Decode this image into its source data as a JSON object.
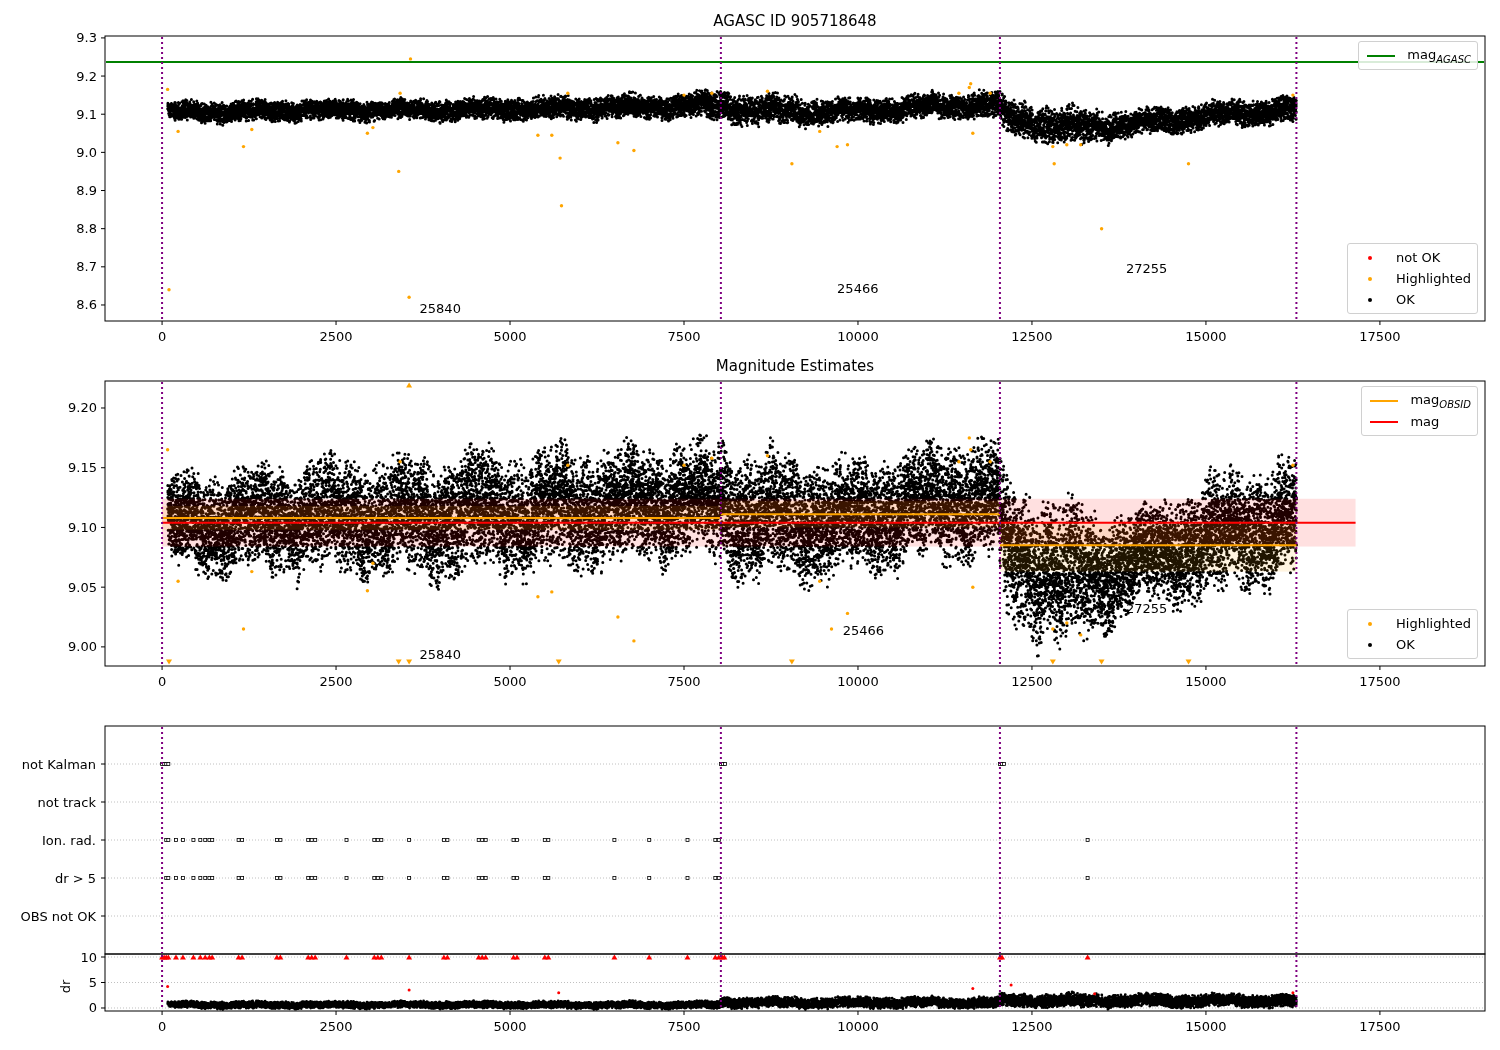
{
  "figure": {
    "panels": [
      {
        "title": "AGASC ID 905718648",
        "yticks": [
          "9.3",
          "9.2",
          "9.1",
          "9.0",
          "8.9",
          "8.8",
          "8.7",
          "8.6"
        ],
        "xticks": [
          "0",
          "2500",
          "5000",
          "7500",
          "10000",
          "12500",
          "15000",
          "17500"
        ],
        "annotations": [
          "25840",
          "25466",
          "27255"
        ],
        "legends": [
          {
            "entries": [
              {
                "label": "mag$_{AGASC}$",
                "kind": "line",
                "color": "#008000"
              }
            ]
          },
          {
            "entries": [
              {
                "label": "not OK",
                "kind": "dot",
                "color": "#ff0000"
              },
              {
                "label": "Highlighted",
                "kind": "dot",
                "color": "#ffa500"
              },
              {
                "label": "OK",
                "kind": "dot",
                "color": "#000000"
              }
            ]
          }
        ]
      },
      {
        "title": "Magnitude Estimates",
        "yticks": [
          "9.20",
          "9.15",
          "9.10",
          "9.05",
          "9.00"
        ],
        "xticks": [
          "0",
          "2500",
          "5000",
          "7500",
          "10000",
          "12500",
          "15000",
          "17500"
        ],
        "annotations": [
          "25840",
          "25466",
          "27255"
        ],
        "legends": [
          {
            "entries": [
              {
                "label": "mag$_{OBSID}$",
                "kind": "line",
                "color": "#ffa500"
              },
              {
                "label": "mag",
                "kind": "line",
                "color": "#ff0000"
              }
            ]
          },
          {
            "entries": [
              {
                "label": "Highlighted",
                "kind": "dot",
                "color": "#ffa500"
              },
              {
                "label": "OK",
                "kind": "dot",
                "color": "#000000"
              }
            ]
          }
        ]
      },
      {
        "rows": [
          "not Kalman",
          "not track",
          "Ion. rad.",
          "dr > 5",
          "OBS not OK"
        ],
        "ylabel": "dr",
        "yticks": [
          "10",
          "5",
          "0"
        ],
        "xticks": [
          "0",
          "2500",
          "5000",
          "7500",
          "10000",
          "12500",
          "15000",
          "17500"
        ]
      }
    ]
  }
}
